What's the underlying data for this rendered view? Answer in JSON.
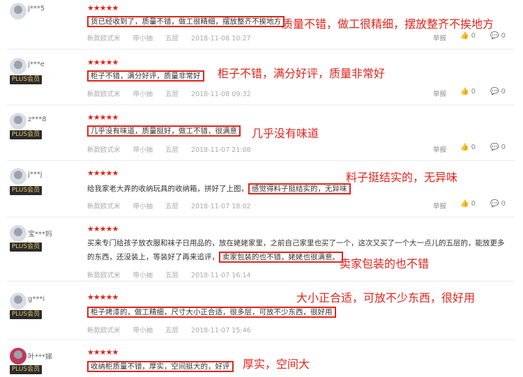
{
  "reviews": [
    {
      "user": "j***5",
      "plus": "",
      "rows": [
        {
          "pre": "",
          "hl": "货已经收到了，质量不错，做工很精细，摆放整齐不挨地方",
          "post": ""
        }
      ],
      "meta": [
        "新款欧式米",
        "带小抽",
        "五层",
        "2018-11-08 10:27"
      ],
      "annotation": "质量不错，做工很精细，摆放整齐不挨地方"
    },
    {
      "user": "j***e",
      "plus": "PLUS会员",
      "rows": [
        {
          "pre": "",
          "hl": "柜子不错，满分好评，质量非常好",
          "post": ""
        }
      ],
      "meta": [
        "新款欧式米",
        "带小抽",
        "五层",
        "2018-11-08 09:32"
      ],
      "annotation": "柜子不错，满分好评，质量非常好"
    },
    {
      "user": "z***8",
      "plus": "PLUS会员",
      "rows": [
        {
          "pre": "",
          "hl": "几乎没有味道，质量挺好，做工不错，很满意",
          "post": ""
        }
      ],
      "meta": [
        "新款欧式米",
        "带小抽",
        "五层",
        "2018-11-07 21:08"
      ],
      "annotation": "几乎没有味道"
    },
    {
      "user": "j***j",
      "plus": "PLUS会员",
      "rows": [
        {
          "pre": "给我家老大弄的收纳玩具的收纳箱，拼好了上图，",
          "hl": "感觉得料子挺结实的，无异味",
          "post": ""
        }
      ],
      "meta": [
        "新款欧式米",
        "带小抽",
        "五层",
        "2018-11-07 18:02"
      ],
      "annotation": "料子挺结实的，无异味"
    },
    {
      "user": "宝***妈",
      "plus": "PLUS会员",
      "rows": [
        {
          "pre": "买来专门给孩子放衣服和袜子日用品的，放在姥姥家里，之前自己家里也买了一个，这次又买了一个大一点儿的五层的，能放更多",
          "hl": "",
          "post": ""
        },
        {
          "pre": "的东西，还没装上，等装好了再来追评，",
          "hl": "卖家包装的也不错，姥姥也很满意。",
          "post": ""
        }
      ],
      "meta": [
        "新款欧式米",
        "带小抽",
        "五层",
        "2018-11-07 16:14"
      ],
      "annotation": "卖家包装的也不错"
    },
    {
      "user": "g***i",
      "plus": "PLUS会员",
      "rows": [
        {
          "pre": "",
          "hl": "柜子烤漆的，做工精细，尺寸大小正合适，很多层，可放不少东西，很好用",
          "post": ""
        }
      ],
      "meta": [
        "新款欧式米",
        "带小抽",
        "五层",
        "2018-11-07 15:46"
      ],
      "annotation": "大小正合适，可放不少东西，很好用"
    },
    {
      "user": "叶***娣",
      "plus": "PLUS会员",
      "rows": [
        {
          "pre": "",
          "hl": "收纳柜质量不错，厚实，空间挺大的，好评",
          "post": ""
        }
      ],
      "meta": [],
      "annotation": "厚实，空间大"
    }
  ],
  "actions": {
    "report": "举报",
    "like_count": "0",
    "comment_count": "0"
  },
  "stars": "★★★★★",
  "colors": {
    "accent": "#e2231a"
  }
}
